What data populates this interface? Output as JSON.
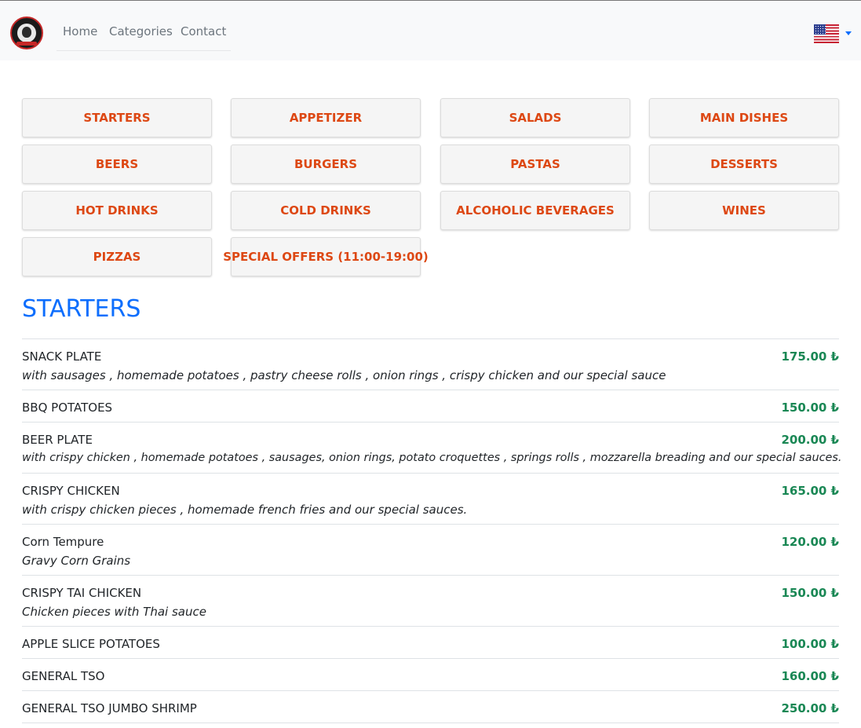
{
  "nav": {
    "links": [
      "Home",
      "Categories",
      "Contact"
    ],
    "language": "English (US)"
  },
  "categories": [
    "STARTERS",
    "APPETIZER",
    "SALADS",
    "MAIN DISHES",
    "BEERS",
    "BURGERS",
    "PASTAS",
    "DESSERTS",
    "HOT DRINKS",
    "COLD DRINKS",
    "ALCOHOLIC BEVERAGES",
    "WINES",
    "PIZZAS",
    "SPECIAL OFFERS (11:00-19:00)"
  ],
  "section": {
    "title": "STARTERS",
    "items": [
      {
        "name": "SNACK PLATE",
        "price": "175.00 ₺",
        "desc": "with sausages , homemade potatoes , pastry cheese rolls , onion rings , crispy chicken and our special sauce"
      },
      {
        "name": "BBQ POTATOES",
        "price": "150.00 ₺",
        "desc": ""
      },
      {
        "name": "BEER PLATE",
        "price": "200.00 ₺",
        "desc": "with crispy chicken , homemade potatoes , sausages, onion rings, potato croquettes , springs rolls , mozzarella breading and our special sauces."
      },
      {
        "name": "CRISPY CHICKEN",
        "price": "165.00 ₺",
        "desc": "with crispy chicken pieces , homemade french fries and our special sauces."
      },
      {
        "name": "Corn Tempure",
        "price": "120.00 ₺",
        "desc": "Gravy Corn Grains"
      },
      {
        "name": "CRISPY TAI CHICKEN",
        "price": "150.00 ₺",
        "desc": "Chicken pieces with Thai sauce"
      },
      {
        "name": "APPLE SLICE POTATOES",
        "price": "100.00 ₺",
        "desc": ""
      },
      {
        "name": "GENERAL TSO",
        "price": "160.00 ₺",
        "desc": ""
      },
      {
        "name": "GENERAL TSO JUMBO SHRIMP",
        "price": "250.00 ₺",
        "desc": ""
      }
    ]
  },
  "colors": {
    "category_text": "#dd4814",
    "section_title": "#0d6efd",
    "price": "#198754"
  }
}
